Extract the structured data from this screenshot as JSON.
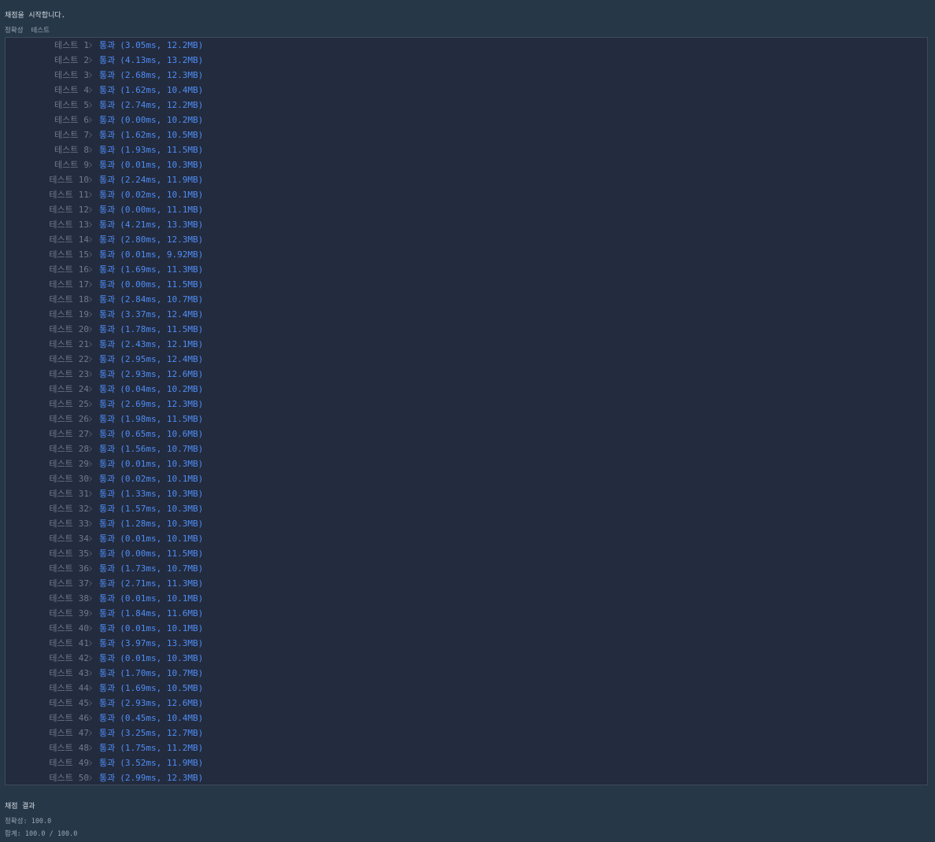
{
  "console": {
    "status": "채점을 시작합니다.",
    "section_label": "정확성",
    "section_sub": "테스트"
  },
  "tests": [
    {
      "label": "테스트",
      "num": "1",
      "result": "통과",
      "detail": "(3.05ms, 12.2MB)"
    },
    {
      "label": "테스트",
      "num": "2",
      "result": "통과",
      "detail": "(4.13ms, 13.2MB)"
    },
    {
      "label": "테스트",
      "num": "3",
      "result": "통과",
      "detail": "(2.68ms, 12.3MB)"
    },
    {
      "label": "테스트",
      "num": "4",
      "result": "통과",
      "detail": "(1.62ms, 10.4MB)"
    },
    {
      "label": "테스트",
      "num": "5",
      "result": "통과",
      "detail": "(2.74ms, 12.2MB)"
    },
    {
      "label": "테스트",
      "num": "6",
      "result": "통과",
      "detail": "(0.00ms, 10.2MB)"
    },
    {
      "label": "테스트",
      "num": "7",
      "result": "통과",
      "detail": "(1.62ms, 10.5MB)"
    },
    {
      "label": "테스트",
      "num": "8",
      "result": "통과",
      "detail": "(1.93ms, 11.5MB)"
    },
    {
      "label": "테스트",
      "num": "9",
      "result": "통과",
      "detail": "(0.01ms, 10.3MB)"
    },
    {
      "label": "테스트",
      "num": "10",
      "result": "통과",
      "detail": "(2.24ms, 11.9MB)"
    },
    {
      "label": "테스트",
      "num": "11",
      "result": "통과",
      "detail": "(0.02ms, 10.1MB)"
    },
    {
      "label": "테스트",
      "num": "12",
      "result": "통과",
      "detail": "(0.00ms, 11.1MB)"
    },
    {
      "label": "테스트",
      "num": "13",
      "result": "통과",
      "detail": "(4.21ms, 13.3MB)"
    },
    {
      "label": "테스트",
      "num": "14",
      "result": "통과",
      "detail": "(2.80ms, 12.3MB)"
    },
    {
      "label": "테스트",
      "num": "15",
      "result": "통과",
      "detail": "(0.01ms, 9.92MB)"
    },
    {
      "label": "테스트",
      "num": "16",
      "result": "통과",
      "detail": "(1.69ms, 11.3MB)"
    },
    {
      "label": "테스트",
      "num": "17",
      "result": "통과",
      "detail": "(0.00ms, 11.5MB)"
    },
    {
      "label": "테스트",
      "num": "18",
      "result": "통과",
      "detail": "(2.84ms, 10.7MB)"
    },
    {
      "label": "테스트",
      "num": "19",
      "result": "통과",
      "detail": "(3.37ms, 12.4MB)"
    },
    {
      "label": "테스트",
      "num": "20",
      "result": "통과",
      "detail": "(1.78ms, 11.5MB)"
    },
    {
      "label": "테스트",
      "num": "21",
      "result": "통과",
      "detail": "(2.43ms, 12.1MB)"
    },
    {
      "label": "테스트",
      "num": "22",
      "result": "통과",
      "detail": "(2.95ms, 12.4MB)"
    },
    {
      "label": "테스트",
      "num": "23",
      "result": "통과",
      "detail": "(2.93ms, 12.6MB)"
    },
    {
      "label": "테스트",
      "num": "24",
      "result": "통과",
      "detail": "(0.04ms, 10.2MB)"
    },
    {
      "label": "테스트",
      "num": "25",
      "result": "통과",
      "detail": "(2.69ms, 12.3MB)"
    },
    {
      "label": "테스트",
      "num": "26",
      "result": "통과",
      "detail": "(1.98ms, 11.5MB)"
    },
    {
      "label": "테스트",
      "num": "27",
      "result": "통과",
      "detail": "(0.65ms, 10.6MB)"
    },
    {
      "label": "테스트",
      "num": "28",
      "result": "통과",
      "detail": "(1.56ms, 10.7MB)"
    },
    {
      "label": "테스트",
      "num": "29",
      "result": "통과",
      "detail": "(0.01ms, 10.3MB)"
    },
    {
      "label": "테스트",
      "num": "30",
      "result": "통과",
      "detail": "(0.02ms, 10.1MB)"
    },
    {
      "label": "테스트",
      "num": "31",
      "result": "통과",
      "detail": "(1.33ms, 10.3MB)"
    },
    {
      "label": "테스트",
      "num": "32",
      "result": "통과",
      "detail": "(1.57ms, 10.3MB)"
    },
    {
      "label": "테스트",
      "num": "33",
      "result": "통과",
      "detail": "(1.28ms, 10.3MB)"
    },
    {
      "label": "테스트",
      "num": "34",
      "result": "통과",
      "detail": "(0.01ms, 10.1MB)"
    },
    {
      "label": "테스트",
      "num": "35",
      "result": "통과",
      "detail": "(0.00ms, 11.5MB)"
    },
    {
      "label": "테스트",
      "num": "36",
      "result": "통과",
      "detail": "(1.73ms, 10.7MB)"
    },
    {
      "label": "테스트",
      "num": "37",
      "result": "통과",
      "detail": "(2.71ms, 11.3MB)"
    },
    {
      "label": "테스트",
      "num": "38",
      "result": "통과",
      "detail": "(0.01ms, 10.1MB)"
    },
    {
      "label": "테스트",
      "num": "39",
      "result": "통과",
      "detail": "(1.84ms, 11.6MB)"
    },
    {
      "label": "테스트",
      "num": "40",
      "result": "통과",
      "detail": "(0.01ms, 10.1MB)"
    },
    {
      "label": "테스트",
      "num": "41",
      "result": "통과",
      "detail": "(3.97ms, 13.3MB)"
    },
    {
      "label": "테스트",
      "num": "42",
      "result": "통과",
      "detail": "(0.01ms, 10.3MB)"
    },
    {
      "label": "테스트",
      "num": "43",
      "result": "통과",
      "detail": "(1.70ms, 10.7MB)"
    },
    {
      "label": "테스트",
      "num": "44",
      "result": "통과",
      "detail": "(1.69ms, 10.5MB)"
    },
    {
      "label": "테스트",
      "num": "45",
      "result": "통과",
      "detail": "(2.93ms, 12.6MB)"
    },
    {
      "label": "테스트",
      "num": "46",
      "result": "통과",
      "detail": "(0.45ms, 10.4MB)"
    },
    {
      "label": "테스트",
      "num": "47",
      "result": "통과",
      "detail": "(3.25ms, 12.7MB)"
    },
    {
      "label": "테스트",
      "num": "48",
      "result": "통과",
      "detail": "(1.75ms, 11.2MB)"
    },
    {
      "label": "테스트",
      "num": "49",
      "result": "통과",
      "detail": "(3.52ms, 11.9MB)"
    },
    {
      "label": "테스트",
      "num": "50",
      "result": "통과",
      "detail": "(2.99ms, 12.3MB)"
    }
  ],
  "summary": {
    "title": "채점 결과",
    "accuracy": "정확성: 100.0",
    "total": "합계: 100.0 / 100.0"
  },
  "colors": {
    "background": "#263747",
    "panel": "#232b3e",
    "pass": "#4e8df5",
    "muted": "#6f7b8a"
  },
  "icons": {
    "row_separator": "chevron-right-icon"
  }
}
